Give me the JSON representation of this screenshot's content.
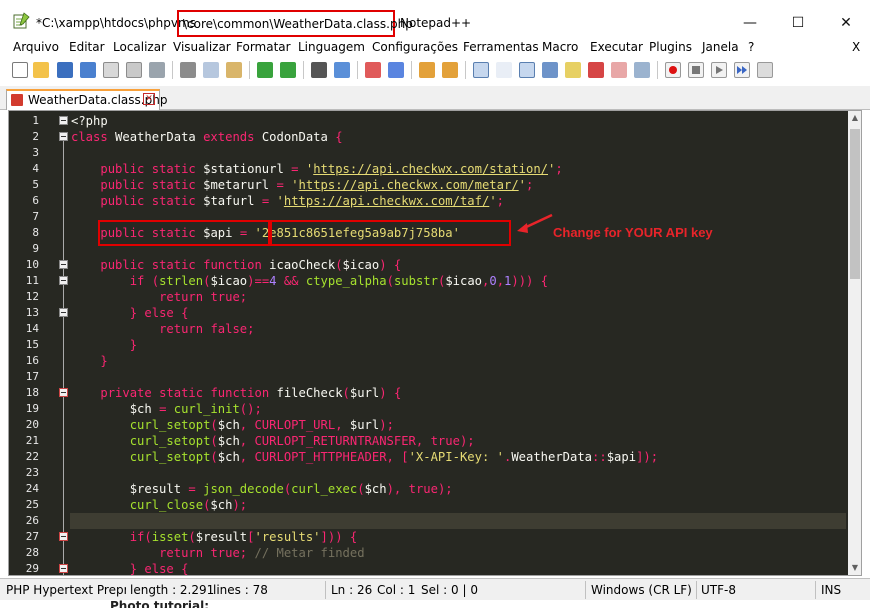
{
  "window": {
    "title_prefix": "*C:\\xampp\\htdocs\\phpvms",
    "title_highlight": "\\core\\common\\WeatherData.class.php",
    "title_suffix": "Notepad++",
    "minimize": "—",
    "maximize": "☐",
    "close": "✕"
  },
  "menu": {
    "items": [
      "Arquivo",
      "Editar",
      "Localizar",
      "Visualizar",
      "Formatar",
      "Linguagem",
      "Configurações",
      "Ferramentas",
      "Macro",
      "Executar",
      "Plugins",
      "Janela",
      "?"
    ],
    "close_doc": "X"
  },
  "toolbar": {
    "icons": [
      "new-file-icon",
      "open-file-icon",
      "save-icon",
      "save-all-icon",
      "close-icon",
      "close-all-icon",
      "print-icon",
      "cut-icon",
      "copy-icon",
      "paste-icon",
      "undo-icon",
      "redo-icon",
      "find-icon",
      "replace-icon",
      "zoom-in-icon",
      "zoom-out-icon",
      "sync-v-icon",
      "sync-h-icon",
      "word-wrap-icon",
      "show-all-chars-icon",
      "indent-guide-icon",
      "udl-icon",
      "doc-map-icon",
      "function-list-icon",
      "folder-workspace-icon",
      "monitor-icon",
      "record-macro-icon",
      "stop-macro-icon",
      "play-macro-icon",
      "run-macro-multi-icon",
      "save-macro-icon"
    ]
  },
  "tab": {
    "label": "WeatherData.class.php",
    "close": "✕"
  },
  "editor": {
    "lines": [
      {
        "n": "1"
      },
      {
        "n": "2"
      },
      {
        "n": "3"
      },
      {
        "n": "4"
      },
      {
        "n": "5"
      },
      {
        "n": "6"
      },
      {
        "n": "7"
      },
      {
        "n": "8"
      },
      {
        "n": "9"
      },
      {
        "n": "10"
      },
      {
        "n": "11"
      },
      {
        "n": "12"
      },
      {
        "n": "13"
      },
      {
        "n": "14"
      },
      {
        "n": "15"
      },
      {
        "n": "16"
      },
      {
        "n": "17"
      },
      {
        "n": "18"
      },
      {
        "n": "19"
      },
      {
        "n": "20"
      },
      {
        "n": "21"
      },
      {
        "n": "22"
      },
      {
        "n": "23"
      },
      {
        "n": "24"
      },
      {
        "n": "25"
      },
      {
        "n": "26"
      },
      {
        "n": "27"
      },
      {
        "n": "28"
      },
      {
        "n": "29"
      }
    ],
    "api_key": "'2e851c8651efeg5a9ab7j758ba'",
    "annotation": "Change for YOUR API key"
  },
  "status": {
    "language": "PHP Hypertext Preprocessor",
    "length": "length : 2.291",
    "lines": "lines : 78",
    "ln": "Ln : 26",
    "col": "Col : 1",
    "sel": "Sel : 0 | 0",
    "eol": "Windows (CR LF)",
    "encoding": "UTF-8",
    "mode": "INS"
  },
  "below": "Photo tutorial:",
  "colors": {
    "editor_bg": "#272822",
    "keyword": "#f92672",
    "string": "#e6db74",
    "function": "#a6e22e",
    "highlight_border": "#e00000"
  }
}
